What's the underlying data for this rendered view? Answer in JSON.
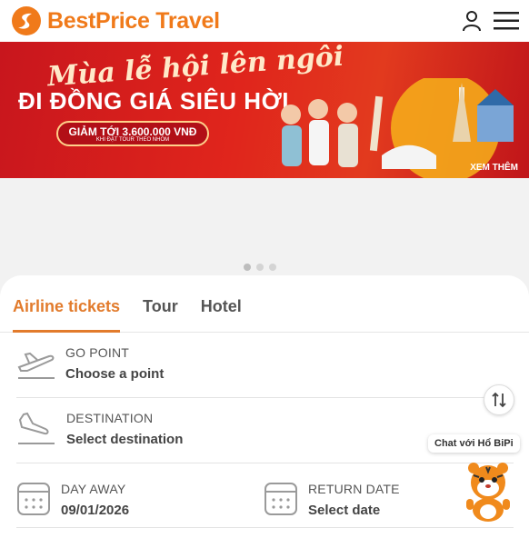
{
  "header": {
    "brand": "BestPrice Travel",
    "user_icon": "user-icon",
    "menu_icon": "hamburger-menu-icon"
  },
  "banner": {
    "script_text": "Mùa lễ hội lên ngôi",
    "title": "ĐI ĐỒNG GIÁ SIÊU HỜI",
    "pill_text": "GIẢM TỚI 3.600.000 VNĐ",
    "pill_subtext": "KHI ĐẶT TOUR THEO NHÓM",
    "cta": "XEM THÊM",
    "colors": {
      "background": "#d81e1b",
      "accent": "#ffd08a"
    }
  },
  "carousel": {
    "dots": 3,
    "active_index": 0
  },
  "tabs": [
    {
      "label": "Airline tickets",
      "active": true
    },
    {
      "label": "Tour",
      "active": false
    },
    {
      "label": "Hotel",
      "active": false
    }
  ],
  "form": {
    "go_point": {
      "label": "GO POINT",
      "value": "Choose a point",
      "icon": "airplane-takeoff-icon"
    },
    "destination": {
      "label": "DESTINATION",
      "value": "Select destination",
      "icon": "airplane-landing-icon"
    },
    "day_away": {
      "label": "DAY AWAY",
      "value": "09/01/2026",
      "icon": "calendar-icon"
    },
    "return_date": {
      "label": "RETURN DATE",
      "value": "Select date",
      "icon": "calendar-icon"
    },
    "swap_icon": "swap-arrows-icon"
  },
  "chat": {
    "label": "Chat với Hổ BiPi",
    "icon": "tiger-mascot-icon"
  },
  "colors": {
    "brand": "#f07a1a",
    "tab_active": "#e27b2c"
  }
}
